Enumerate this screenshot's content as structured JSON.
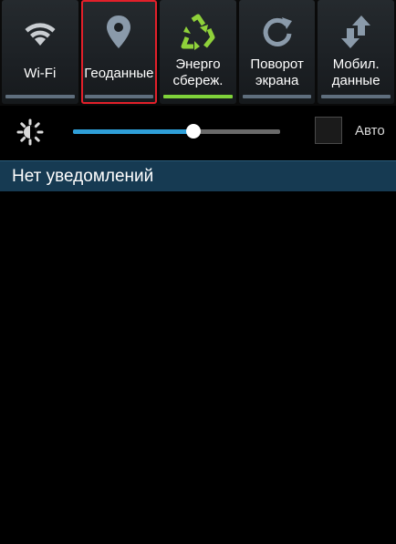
{
  "quick_settings": {
    "toggles": [
      {
        "label": "Wi-Fi",
        "icon": "wifi-icon",
        "state": "off"
      },
      {
        "label": "Геоданные",
        "icon": "location-pin-icon",
        "state": "off",
        "highlighted": true
      },
      {
        "label": "Энерго\nсбереж.",
        "icon": "recycle-icon",
        "state": "on"
      },
      {
        "label": "Поворот\nэкрана",
        "icon": "rotate-icon",
        "state": "off"
      },
      {
        "label": "Мобил.\nданные",
        "icon": "mobile-data-icon",
        "state": "off"
      }
    ],
    "highlight_color": "#e2202a",
    "on_color": "#7fd23a",
    "off_color": "#5f6e7d"
  },
  "brightness": {
    "icon": "brightness-sun-icon",
    "level": 0.58,
    "auto_label": "Авто",
    "auto_checked": false
  },
  "notifications": {
    "header": "Нет уведомлений"
  }
}
